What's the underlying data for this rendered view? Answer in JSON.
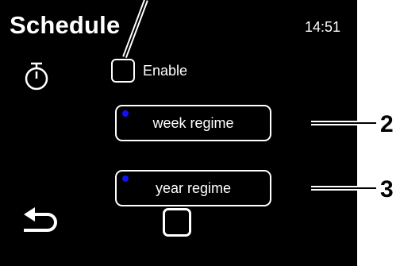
{
  "header": {
    "title": "Schedule",
    "time": "14:51"
  },
  "icons": {
    "timer": "stopwatch-icon",
    "back": "back-arrow-icon",
    "home": "square-icon"
  },
  "enable": {
    "label": "Enable",
    "checked": false
  },
  "buttons": {
    "week": "week regime",
    "year": "year regime"
  },
  "callouts": {
    "two": "2",
    "three": "3"
  },
  "colors": {
    "screen_bg": "#000000",
    "foreground": "#ffffff",
    "indicator_dot": "#1010ff"
  }
}
